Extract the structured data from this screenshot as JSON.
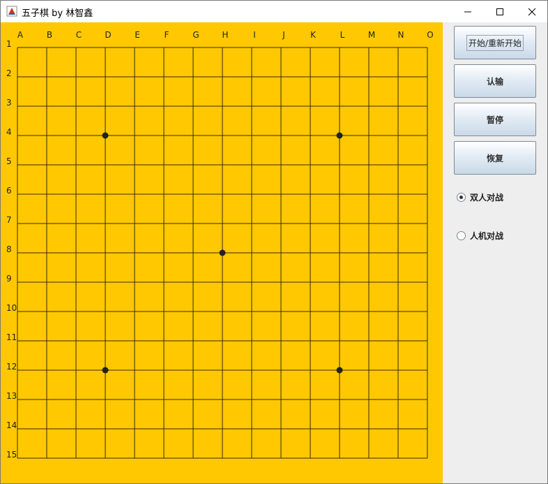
{
  "window": {
    "title": "五子棋 by 林智鑫"
  },
  "board": {
    "col_labels": [
      "A",
      "B",
      "C",
      "D",
      "E",
      "F",
      "G",
      "H",
      "I",
      "J",
      "K",
      "L",
      "M",
      "N",
      "O"
    ],
    "row_labels": [
      "1",
      "2",
      "3",
      "4",
      "5",
      "6",
      "7",
      "8",
      "9",
      "10",
      "11",
      "12",
      "13",
      "14",
      "15"
    ],
    "star_points": [
      "D4",
      "L4",
      "H8",
      "D12",
      "L12"
    ]
  },
  "controls": {
    "start_label": "开始/重新开始",
    "resign_label": "认输",
    "pause_label": "暂停",
    "resume_label": "恢复",
    "mode_pvp_label": "双人对战",
    "mode_pve_label": "人机对战",
    "selected_mode": "双人对战"
  },
  "colors": {
    "board": "#ffc800",
    "line": "#3a2a00",
    "star": "#222222"
  }
}
